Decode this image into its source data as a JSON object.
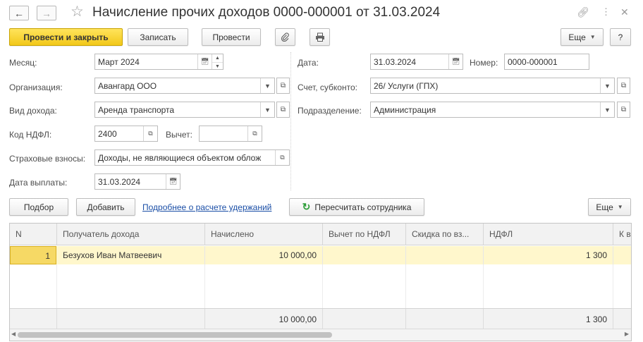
{
  "window": {
    "title": "Начисление прочих доходов 0000-000001 от 31.03.2024",
    "back_icon": "arrow-left-icon",
    "forward_icon": "arrow-right-icon",
    "favorite_icon": "star-icon",
    "link_icon": "link-icon",
    "more_icon": "vertical-dots-icon",
    "close_icon": "close-icon"
  },
  "toolbar": {
    "post_close": "Провести и закрыть",
    "save": "Записать",
    "post": "Провести",
    "attach_icon": "paperclip-icon",
    "print_icon": "printer-icon",
    "more": "Еще",
    "help": "?"
  },
  "form": {
    "month_label": "Месяц:",
    "month_value": "Март 2024",
    "org_label": "Организация:",
    "org_value": "Авангард ООО",
    "income_type_label": "Вид дохода:",
    "income_type_value": "Аренда транспорта",
    "ndfl_code_label": "Код НДФЛ:",
    "ndfl_code_value": "2400",
    "deduction_label": "Вычет:",
    "deduction_value": "",
    "insurance_label": "Страховые взносы:",
    "insurance_value": "Доходы, не являющиеся объектом облож",
    "pay_date_label": "Дата выплаты:",
    "pay_date_value": "31.03.2024",
    "date_label": "Дата:",
    "date_value": "31.03.2024",
    "number_label": "Номер:",
    "number_value": "0000-000001",
    "account_label": "Счет, субконто:",
    "account_value": "26/ Услуги (ГПХ)",
    "dept_label": "Подразделение:",
    "dept_value": "Администрация"
  },
  "table_toolbar": {
    "pick": "Подбор",
    "add": "Добавить",
    "details_link": "Подробнее о расчете удержаний",
    "recalc": "Пересчитать сотрудника",
    "recalc_icon": "refresh-icon",
    "more": "Еще"
  },
  "table": {
    "columns": [
      "N",
      "Получатель дохода",
      "Начислено",
      "Вычет по НДФЛ",
      "Скидка по вз...",
      "НДФЛ",
      "К в"
    ],
    "rows": [
      {
        "n": "1",
        "recipient": "Безухов Иван Матвеевич",
        "accrued": "10 000,00",
        "deduction": "",
        "discount": "",
        "ndfl": "1 300",
        "payout": ""
      }
    ],
    "totals": {
      "accrued": "10 000,00",
      "ndfl": "1 300"
    }
  },
  "colors": {
    "primary_button": "#f2c81a",
    "selected_row": "#fff7cc",
    "link": "#1a4ea6",
    "header_bg": "#f2f2f2"
  }
}
